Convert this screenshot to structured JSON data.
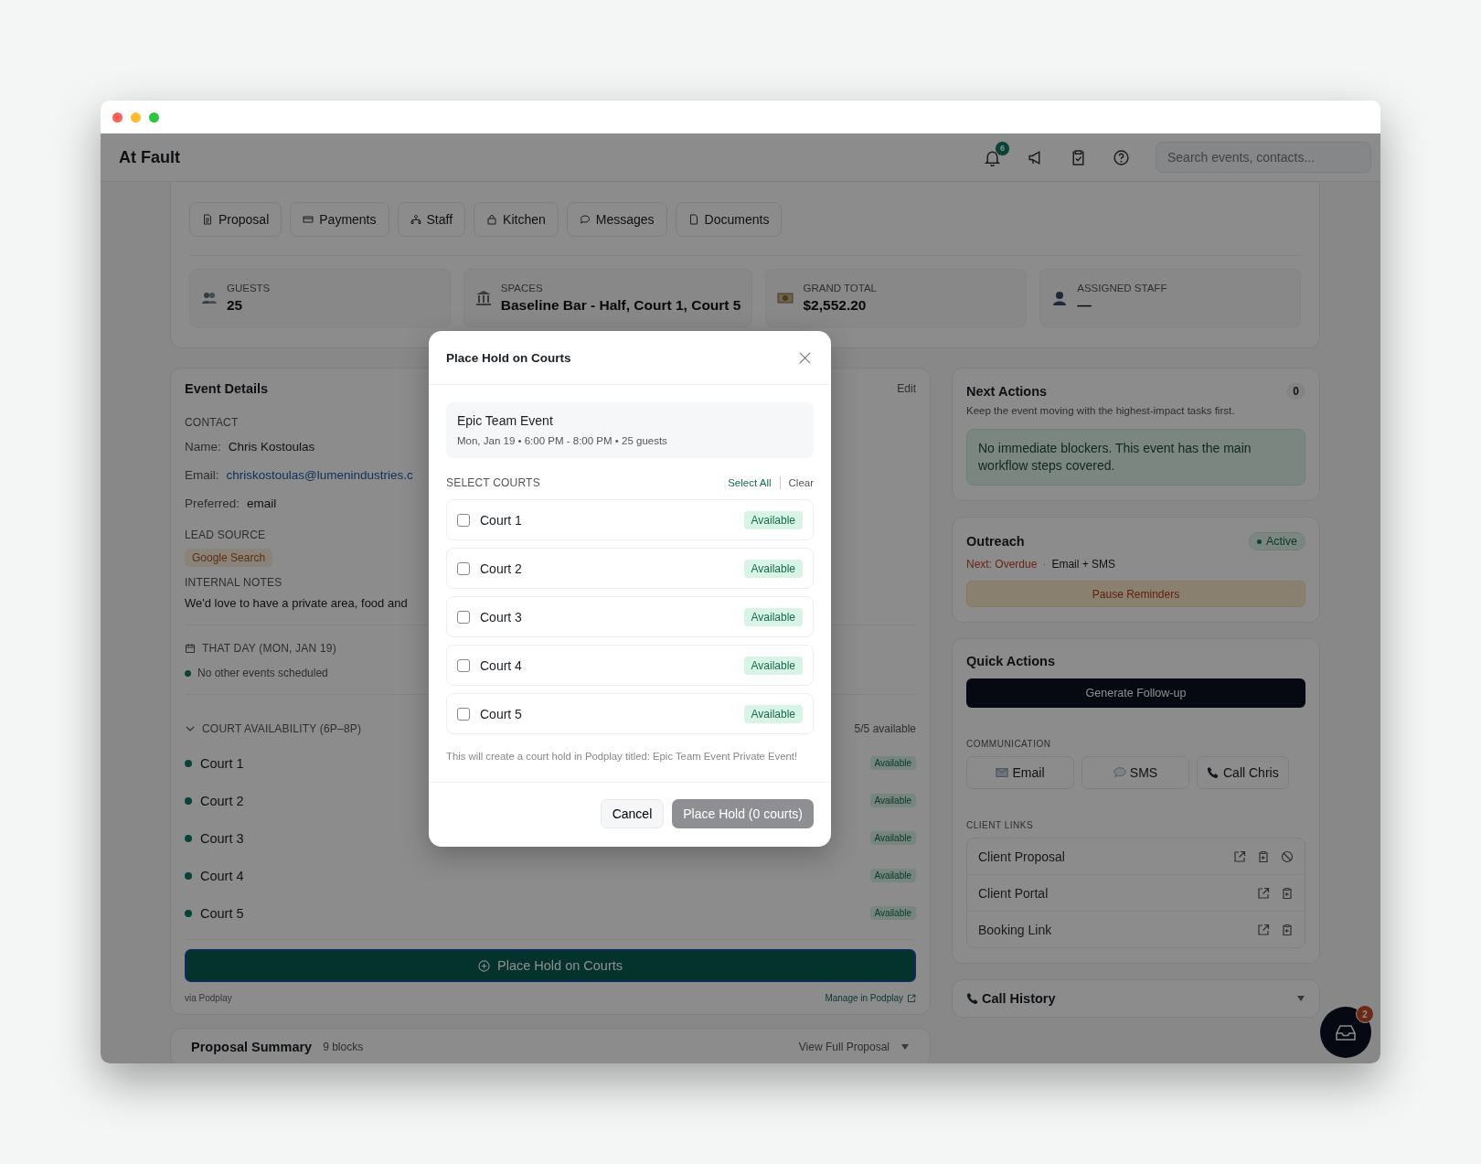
{
  "app": {
    "title": "At Fault",
    "notification_count": "6",
    "search": {
      "placeholder": "Search events, contacts..."
    }
  },
  "tabs": [
    {
      "label": "Proposal",
      "kind": "document"
    },
    {
      "label": "Payments",
      "kind": "card"
    },
    {
      "label": "Staff",
      "kind": "people"
    },
    {
      "label": "Kitchen",
      "kind": "bag"
    },
    {
      "label": "Messages",
      "kind": "chat"
    },
    {
      "label": "Documents",
      "kind": "file"
    }
  ],
  "stats": [
    {
      "label": "GUESTS",
      "value": "25",
      "kind": "guests"
    },
    {
      "label": "SPACES",
      "value": "Baseline Bar - Half, Court 1, Court 5",
      "kind": "building"
    },
    {
      "label": "GRAND TOTAL",
      "value": "$2,552.20",
      "kind": "money"
    },
    {
      "label": "ASSIGNED STAFF",
      "value": "—",
      "kind": "person"
    }
  ],
  "event_details": {
    "title": "Event Details",
    "edit": "Edit",
    "contact_label": "CONTACT",
    "fields": [
      {
        "label": "Name:",
        "value": "Chris Kostoulas",
        "kind": "text"
      },
      {
        "label": "Email:",
        "value": "chriskostoulas@lumenindustries.c",
        "kind": "link"
      },
      {
        "label": "Preferred:",
        "value": "email",
        "kind": "text"
      }
    ],
    "lead_source_label": "LEAD SOURCE",
    "lead_source": "Google Search",
    "notes_label": "INTERNAL NOTES",
    "notes": "We'd love to have a private area, food and",
    "day_label": "THAT DAY (MON, JAN 19)",
    "day_status": "No other events scheduled",
    "availability_label": "COURT AVAILABILITY (6P–8P)",
    "availability_expanded": true,
    "availability_count": "5/5 available",
    "courts": [
      {
        "name": "Court 1",
        "status": "Available"
      },
      {
        "name": "Court 2",
        "status": "Available"
      },
      {
        "name": "Court 3",
        "status": "Available"
      },
      {
        "name": "Court 4",
        "status": "Available"
      },
      {
        "name": "Court 5",
        "status": "Available"
      }
    ],
    "place_hold": "Place Hold on Courts",
    "via": "via Podplay",
    "manage": "Manage in Podplay"
  },
  "proposal_summary": {
    "title": "Proposal Summary",
    "count": "9 blocks",
    "link": "View Full Proposal"
  },
  "next_actions": {
    "title": "Next Actions",
    "count": "0",
    "subtitle": "Keep the event moving with the highest-impact tasks first.",
    "message": "No immediate blockers. This event has the main workflow steps covered."
  },
  "outreach": {
    "title": "Outreach",
    "status": "Active",
    "next": "Next: Overdue",
    "separator": "·",
    "channel": "Email + SMS",
    "pause": "Pause Reminders"
  },
  "quick_actions": {
    "title": "Quick Actions",
    "primary": "Generate Follow-up",
    "communication_label": "COMMUNICATION",
    "communication": [
      {
        "label": "Email",
        "kind": "email"
      },
      {
        "label": "SMS",
        "kind": "sms"
      },
      {
        "label": "Call Chris",
        "kind": "phone"
      }
    ],
    "links_label": "CLIENT LINKS",
    "links": [
      {
        "label": "Client Proposal",
        "revocable": true
      },
      {
        "label": "Client Portal",
        "revocable": false
      },
      {
        "label": "Booking Link",
        "revocable": false
      }
    ]
  },
  "call_history": {
    "title": "Call History",
    "expanded": false
  },
  "chat": {
    "badge": "2"
  },
  "modal": {
    "title": "Place Hold on Courts",
    "event": "Epic Team Event",
    "meta": "Mon, Jan 19 • 6:00 PM - 8:00 PM • 25 guests",
    "select_label": "SELECT COURTS",
    "select_all": "Select All",
    "clear": "Clear",
    "courts": [
      {
        "name": "Court 1",
        "checked": false,
        "status": "Available"
      },
      {
        "name": "Court 2",
        "checked": false,
        "status": "Available"
      },
      {
        "name": "Court 3",
        "checked": false,
        "status": "Available"
      },
      {
        "name": "Court 4",
        "checked": false,
        "status": "Available"
      },
      {
        "name": "Court 5",
        "checked": false,
        "status": "Available"
      }
    ],
    "note": "This will create a court hold in Podplay titled: Epic Team Event Private Event!",
    "cancel": "Cancel",
    "submit": "Place Hold (0 courts)"
  }
}
